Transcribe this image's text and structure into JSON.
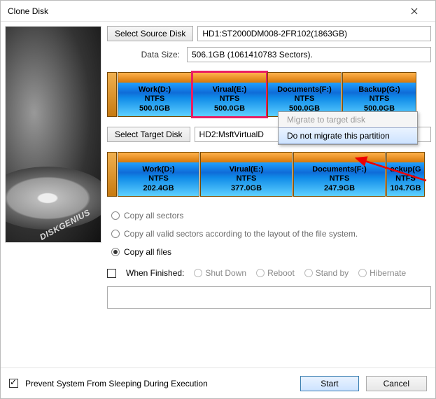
{
  "window": {
    "title": "Clone Disk"
  },
  "source": {
    "button": "Select Source Disk",
    "value": "HD1:ST2000DM008-2FR102(1863GB)",
    "data_size_label": "Data Size:",
    "data_size_value": "506.1GB (1061410783 Sectors).",
    "partitions": [
      {
        "name": "Work(D:)",
        "fs": "NTFS",
        "size": "500.0GB",
        "width": 106
      },
      {
        "name": "Virual(E:)",
        "fs": "NTFS",
        "size": "500.0GB",
        "width": 106,
        "selected": true
      },
      {
        "name": "Documents(F:)",
        "fs": "NTFS",
        "size": "500.0GB",
        "width": 106
      },
      {
        "name": "Backup(G:)",
        "fs": "NTFS",
        "size": "500.0GB",
        "width": 106
      }
    ]
  },
  "context_menu": {
    "items": [
      {
        "label": "Migrate to target disk",
        "disabled": true
      },
      {
        "label": "Do not migrate this partition",
        "hover": true
      }
    ]
  },
  "target": {
    "button": "Select Target Disk",
    "value": "HD2:MsftVirtualD",
    "partitions": [
      {
        "name": "Work(D:)",
        "fs": "NTFS",
        "size": "202.4GB",
        "width": 117
      },
      {
        "name": "Virual(E:)",
        "fs": "NTFS",
        "size": "377.0GB",
        "width": 132
      },
      {
        "name": "Documents(F:)",
        "fs": "NTFS",
        "size": "247.9GB",
        "width": 132
      },
      {
        "name": "ackup(G",
        "fs": "NTFS",
        "size": "104.7GB",
        "width": 55
      }
    ]
  },
  "copy_options": {
    "all_sectors": "Copy all sectors",
    "valid_sectors": "Copy all valid sectors according to the layout of the file system.",
    "all_files": "Copy all files"
  },
  "when_finished": {
    "label": "When Finished:",
    "options": {
      "shutdown": "Shut Down",
      "reboot": "Reboot",
      "standby": "Stand by",
      "hibernate": "Hibernate"
    }
  },
  "footer": {
    "prevent_sleep": "Prevent System From Sleeping During Execution",
    "start": "Start",
    "cancel": "Cancel"
  },
  "preview_label": "DISKGENIUS"
}
